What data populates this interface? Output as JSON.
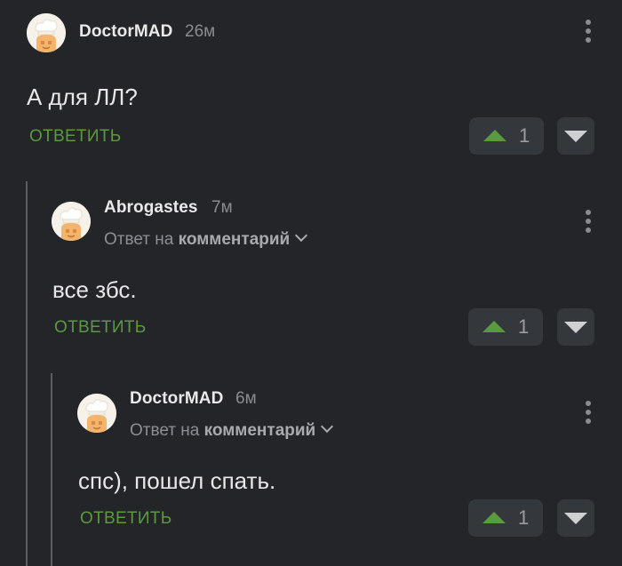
{
  "comments": [
    {
      "author": "DoctorMAD",
      "time": "26м",
      "reply_prefix": "",
      "reply_target": "",
      "text": "А для ЛЛ?",
      "reply_label": "ОТВЕТИТЬ",
      "votes": "1"
    },
    {
      "author": "Abrogastes",
      "time": "7м",
      "reply_prefix": "Ответ на",
      "reply_target": "комментарий",
      "text": "все збс.",
      "reply_label": "ОТВЕТИТЬ",
      "votes": "1"
    },
    {
      "author": "DoctorMAD",
      "time": "6м",
      "reply_prefix": "Ответ на",
      "reply_target": "комментарий",
      "text": "спс), пошел спать.",
      "reply_label": "ОТВЕТИТЬ",
      "votes": "1"
    }
  ],
  "icons": {
    "avatar": "chef-avatar-icon",
    "more": "more-vertical-icon",
    "upvote": "upvote-arrow-icon",
    "downvote": "downvote-arrow-icon",
    "chevron": "chevron-down-icon"
  },
  "colors": {
    "background": "#232529",
    "accent_green": "#5b9a3e",
    "button_bg": "#34373c",
    "thread_line": "#5b5e63"
  }
}
